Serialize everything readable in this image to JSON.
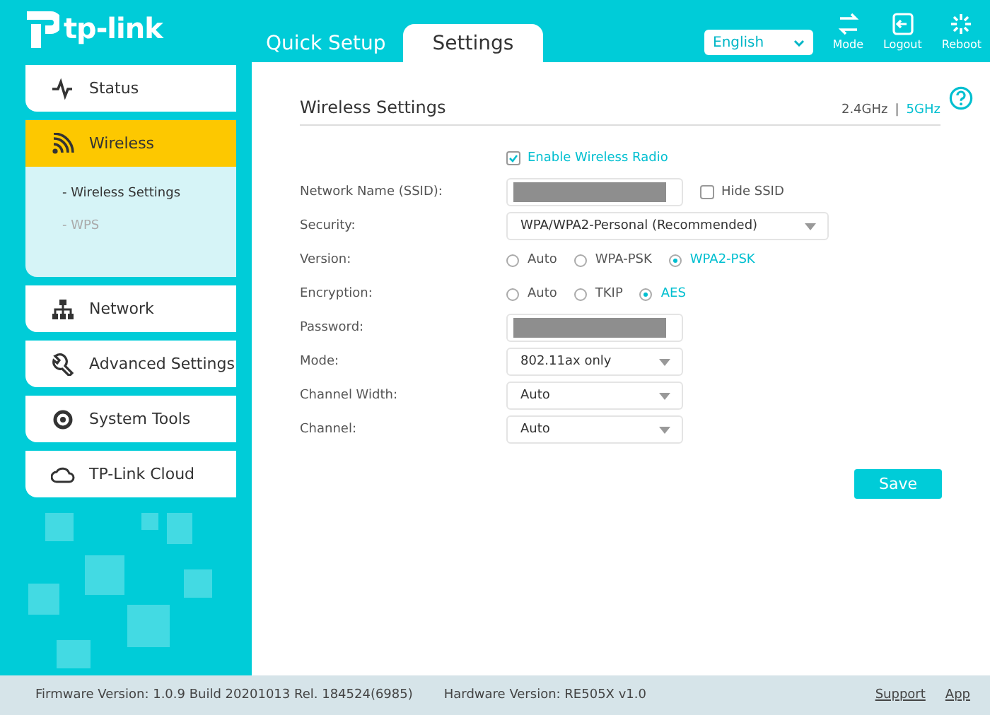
{
  "header": {
    "logo": "tp-link",
    "tabs": [
      {
        "label": "Quick Setup",
        "selected": false
      },
      {
        "label": "Settings",
        "selected": true
      }
    ],
    "language": "English",
    "actions": [
      {
        "kind": "mode",
        "label": "Mode"
      },
      {
        "kind": "logout",
        "label": "Logout"
      },
      {
        "kind": "reboot",
        "label": "Reboot"
      }
    ]
  },
  "sidebar": {
    "items": [
      {
        "label": "Status",
        "selected": false
      },
      {
        "label": "Wireless",
        "selected": true,
        "children": [
          {
            "label": "- Wireless Settings",
            "selected": true
          },
          {
            "label": "- WPS",
            "selected": false
          }
        ]
      },
      {
        "label": "Network",
        "selected": false
      },
      {
        "label": "Advanced Settings",
        "selected": false
      },
      {
        "label": "System Tools",
        "selected": false
      },
      {
        "label": "TP-Link Cloud",
        "selected": false
      }
    ]
  },
  "panel": {
    "title": "Wireless Settings",
    "band_separator": "|",
    "bands": [
      {
        "label": "2.4GHz",
        "selected": false
      },
      {
        "label": "5GHz",
        "selected": true
      }
    ],
    "enable_radio": {
      "label": "Enable Wireless Radio",
      "checked": true
    },
    "fields": [
      {
        "kind": "text",
        "label": "Network Name (SSID):",
        "masked": true,
        "extra": {
          "label": "Hide SSID",
          "checked": false
        }
      },
      {
        "kind": "select",
        "label": "Security:",
        "value": "WPA/WPA2-Personal (Recommended)",
        "wide": true
      },
      {
        "kind": "radio",
        "label": "Version:",
        "options": [
          {
            "label": "Auto",
            "selected": false
          },
          {
            "label": "WPA-PSK",
            "selected": false
          },
          {
            "label": "WPA2-PSK",
            "selected": true
          }
        ]
      },
      {
        "kind": "radio",
        "label": "Encryption:",
        "options": [
          {
            "label": "Auto",
            "selected": false
          },
          {
            "label": "TKIP",
            "selected": false
          },
          {
            "label": "AES",
            "selected": true
          }
        ]
      },
      {
        "kind": "text",
        "label": "Password:",
        "masked": true
      },
      {
        "kind": "select",
        "label": "Mode:",
        "value": "802.11ax only",
        "wide": false
      },
      {
        "kind": "select",
        "label": "Channel Width:",
        "value": "Auto",
        "wide": false
      },
      {
        "kind": "select",
        "label": "Channel:",
        "value": "Auto",
        "wide": false
      }
    ],
    "save": "Save"
  },
  "footer": {
    "firmware": "Firmware Version: 1.0.9 Build 20201013 Rel. 184524(6985)",
    "hardware": "Hardware Version: RE505X v1.0",
    "links": [
      "Support",
      "App"
    ]
  }
}
